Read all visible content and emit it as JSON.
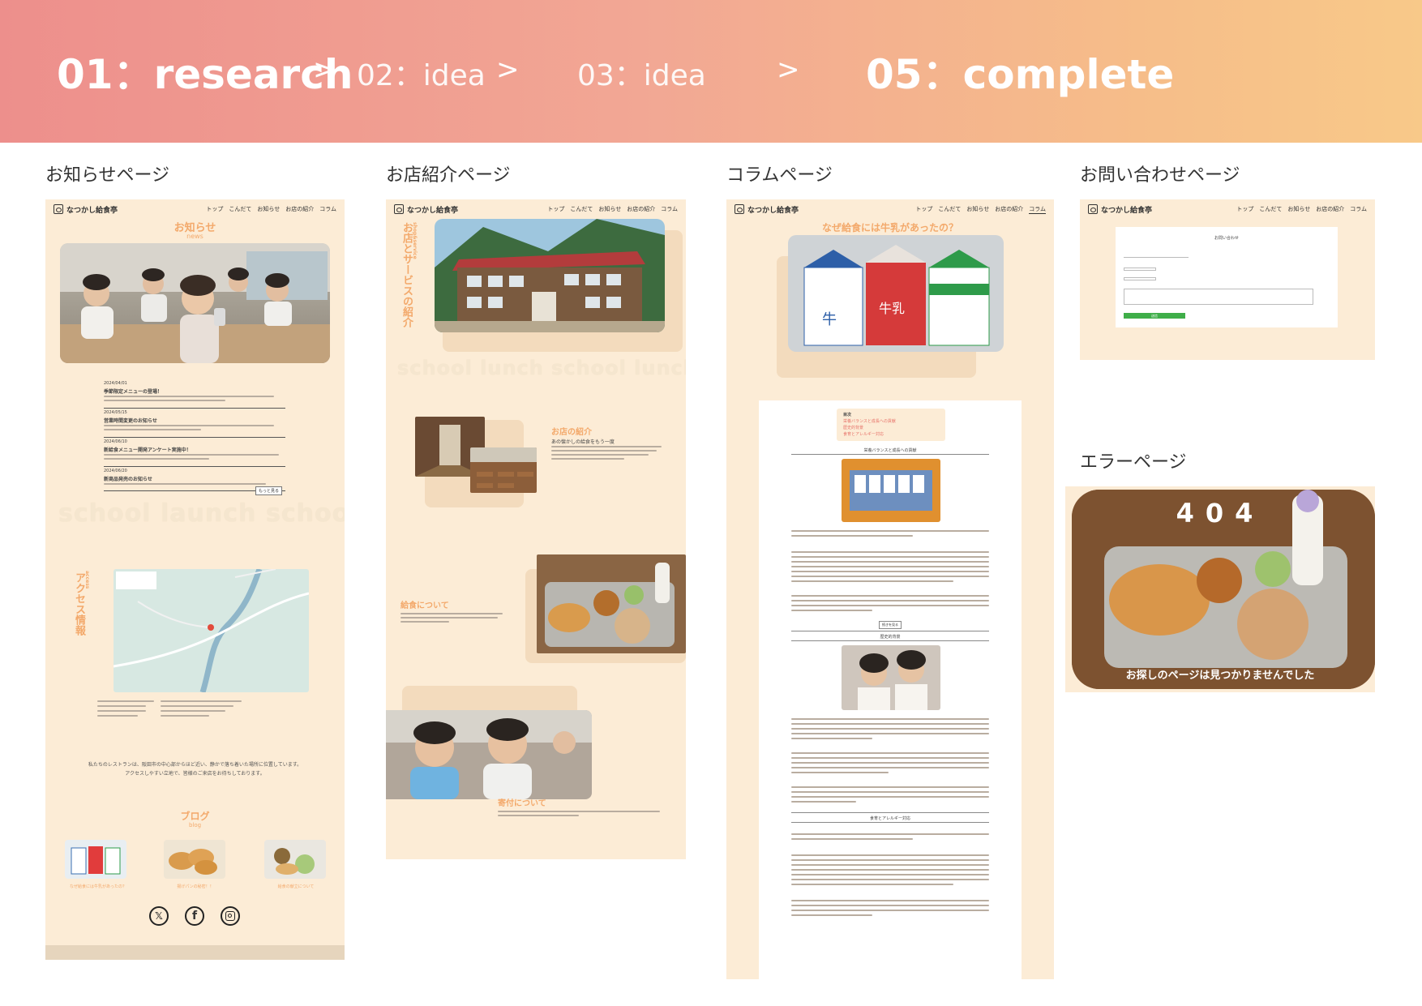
{
  "header": {
    "step1": "01：research",
    "step2": "02：idea",
    "step3": "03：idea",
    "step4": "05：complete",
    "arrow": ">"
  },
  "sections": {
    "news_page": "お知らせページ",
    "shop_page": "お店紹介ページ",
    "column_page": "コラムページ",
    "contact_page": "お問い合わせページ",
    "error_page": "エラーページ"
  },
  "site": {
    "logo": "なつかし給食亭",
    "nav": [
      "トップ",
      "こんだて",
      "お知らせ",
      "お店の紹介",
      "コラム"
    ]
  },
  "news": {
    "title": "お知らせ",
    "subtitle": "news",
    "items": [
      {
        "date": "2024/04/01",
        "title": "季節限定メニューの登場！"
      },
      {
        "date": "2024/05/15",
        "title": "営業時間変更のお知らせ"
      },
      {
        "date": "2024/06/10",
        "title": "新給食メニュー開発アンケート実施中！"
      },
      {
        "date": "2024/06/20",
        "title": "新商品発売のお知らせ"
      }
    ],
    "more_button": "もっと見る",
    "ghost_text": "school launch",
    "ghost_text2": "schoo",
    "access_title": "アクセス情報",
    "access_sub": "access",
    "intro1": "私たちのレストランは、阪田市の中心部からほど近い、静かで落ち着いた場所に位置しています。",
    "intro2": "アクセスしやすい立地で、皆様のご来店をお待ちしております。",
    "blog_title": "ブログ",
    "blog_sub": "blog",
    "blog_items": [
      "なぜ給食には牛乳があったの？",
      "揚げパンの秘密！！",
      "給食の献立について"
    ]
  },
  "shop": {
    "vertical_title": "お店とサービスの紹介",
    "vertical_sub": "shop&service",
    "ghost1": "school lunch",
    "ghost2": "school lunch",
    "intro_title": "お店の紹介",
    "intro_lead": "あの懐かしの給食をもう一度",
    "lunch_title": "給食について",
    "donate_title": "寄付について"
  },
  "column": {
    "title": "なぜ給食には牛乳があったの？",
    "toc_title": "目次",
    "toc": [
      "栄養バランスと成長への貢献",
      "歴史的背景",
      "食育とアレルギー対応"
    ],
    "sec1": "栄養バランスと成長への貢献",
    "sec2": "歴史的背景",
    "sec3": "食育とアレルギー対応",
    "more": "続きを見る"
  },
  "contact": {
    "form_title": "お問い合わせ",
    "submit": "送信"
  },
  "error": {
    "code": "404",
    "message": "お探しのページは見つかりませんでした"
  },
  "colors": {
    "accent": "#f3a96b",
    "page_bg": "#fcecd6",
    "banner_start": "#ed8f8c",
    "banner_end": "#f8c989",
    "submit_green": "#3fae49"
  }
}
